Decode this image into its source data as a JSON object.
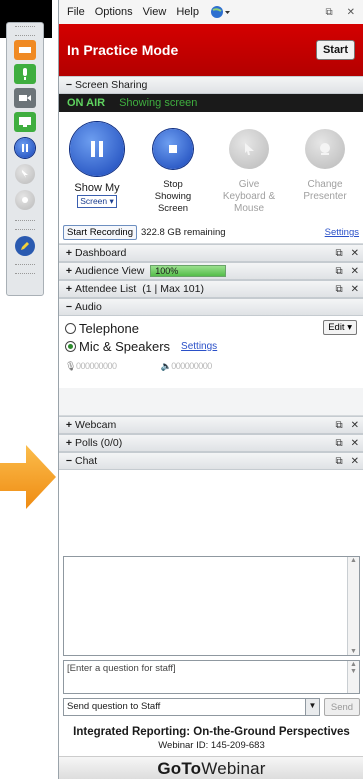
{
  "menubar": {
    "items": [
      "File",
      "Options",
      "View",
      "Help"
    ]
  },
  "mode": {
    "title": "In Practice Mode",
    "start_label": "Start"
  },
  "screen_sharing": {
    "header": "Screen Sharing",
    "on_air": "ON AIR",
    "status": "Showing screen",
    "show_my_label": "Show My",
    "show_my_select": "Screen",
    "stop_label": "Stop Showing Screen",
    "give_kb_label": "Give Keyboard & Mouse",
    "change_presenter_label": "Change Presenter"
  },
  "recording": {
    "button": "Start Recording",
    "remaining": "322.8 GB remaining",
    "settings": "Settings"
  },
  "sections": {
    "dashboard": "Dashboard",
    "audience_view": "Audience View",
    "audience_value": "100%",
    "attendee_list": "Attendee List",
    "attendee_count": "(1 | Max 101)",
    "audio": "Audio",
    "webcam": "Webcam",
    "polls": "Polls (0/0)",
    "chat": "Chat"
  },
  "audience_progress": 1.0,
  "audio": {
    "telephone": "Telephone",
    "mic_speakers": "Mic & Speakers",
    "settings": "Settings",
    "edit": "Edit",
    "mic_meter": "000000000",
    "speaker_meter": "000000000"
  },
  "chat": {
    "question_placeholder": "[Enter a question for staff]",
    "send_to": "Send question to Staff",
    "send": "Send"
  },
  "footer": {
    "title": "Integrated Reporting: On-the-Ground Perspectives",
    "webinar_id": "Webinar ID: 145-209-683",
    "logo_bold": "GoTo",
    "logo_light": "Webinar"
  },
  "colors": {
    "mode_red": "#c00000",
    "accent_blue": "#1845b8",
    "on_air_green": "#5fd35f",
    "arrow_orange": "#f5a623"
  }
}
